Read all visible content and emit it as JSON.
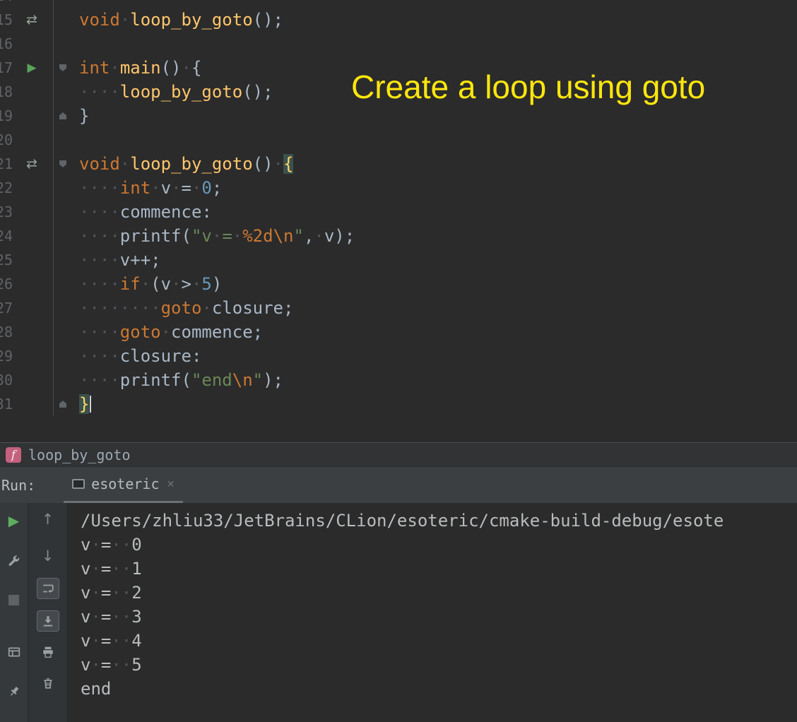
{
  "annotation": {
    "text": "Create a loop using goto",
    "color": "#fde60e"
  },
  "editor": {
    "lines": [
      {
        "n": "14",
        "tokens": []
      },
      {
        "n": "15",
        "g": "arrows",
        "tokens": [
          [
            "kw",
            "void"
          ],
          [
            "sp",
            " "
          ],
          [
            "fn",
            "loop_by_goto"
          ],
          [
            "txt",
            "();"
          ]
        ]
      },
      {
        "n": "16",
        "tokens": []
      },
      {
        "n": "17",
        "g": "run",
        "fold": "start",
        "tokens": [
          [
            "kw",
            "int"
          ],
          [
            "sp",
            " "
          ],
          [
            "fn",
            "main"
          ],
          [
            "txt",
            "()"
          ],
          [
            "sp",
            " "
          ],
          [
            "txt",
            "{"
          ]
        ]
      },
      {
        "n": "18",
        "tokens": [
          [
            "sp",
            "    "
          ],
          [
            "fn",
            "loop_by_goto"
          ],
          [
            "txt",
            "();"
          ]
        ]
      },
      {
        "n": "19",
        "fold": "end",
        "tokens": [
          [
            "txt",
            "}"
          ]
        ]
      },
      {
        "n": "20",
        "tokens": []
      },
      {
        "n": "21",
        "g": "arrows",
        "fold": "start",
        "tokens": [
          [
            "kw",
            "void"
          ],
          [
            "sp",
            " "
          ],
          [
            "fn",
            "loop_by_goto"
          ],
          [
            "txt",
            "()"
          ],
          [
            "sp",
            " "
          ],
          [
            "brace",
            "{"
          ]
        ]
      },
      {
        "n": "22",
        "tokens": [
          [
            "sp",
            "    "
          ],
          [
            "kw",
            "int"
          ],
          [
            "sp",
            " "
          ],
          [
            "txt",
            "v"
          ],
          [
            "sp",
            " "
          ],
          [
            "txt",
            "="
          ],
          [
            "sp",
            " "
          ],
          [
            "num",
            "0"
          ],
          [
            "txt",
            ";"
          ]
        ]
      },
      {
        "n": "23",
        "tokens": [
          [
            "sp",
            "    "
          ],
          [
            "txt",
            "commence:"
          ]
        ]
      },
      {
        "n": "24",
        "tokens": [
          [
            "sp",
            "    "
          ],
          [
            "txt",
            "printf("
          ],
          [
            "str",
            "\"v"
          ],
          [
            "sp",
            " "
          ],
          [
            "str",
            "="
          ],
          [
            "sp",
            " "
          ],
          [
            "fmt",
            "%2d"
          ],
          [
            "fmt",
            "\\n"
          ],
          [
            "str",
            "\""
          ],
          [
            "txt",
            ","
          ],
          [
            "sp",
            " "
          ],
          [
            "txt",
            "v);"
          ]
        ]
      },
      {
        "n": "25",
        "tokens": [
          [
            "sp",
            "    "
          ],
          [
            "txt",
            "v++;"
          ]
        ]
      },
      {
        "n": "26",
        "tokens": [
          [
            "sp",
            "    "
          ],
          [
            "kw",
            "if"
          ],
          [
            "sp",
            " "
          ],
          [
            "txt",
            "(v"
          ],
          [
            "sp",
            " "
          ],
          [
            "txt",
            ">"
          ],
          [
            "sp",
            " "
          ],
          [
            "num",
            "5"
          ],
          [
            "txt",
            ")"
          ]
        ]
      },
      {
        "n": "27",
        "tokens": [
          [
            "sp",
            "        "
          ],
          [
            "kw",
            "goto"
          ],
          [
            "sp",
            " "
          ],
          [
            "txt",
            "closure;"
          ]
        ]
      },
      {
        "n": "28",
        "tokens": [
          [
            "sp",
            "    "
          ],
          [
            "kw",
            "goto"
          ],
          [
            "sp",
            " "
          ],
          [
            "txt",
            "commence;"
          ]
        ]
      },
      {
        "n": "29",
        "tokens": [
          [
            "sp",
            "    "
          ],
          [
            "txt",
            "closure:"
          ]
        ]
      },
      {
        "n": "30",
        "tokens": [
          [
            "sp",
            "    "
          ],
          [
            "txt",
            "printf("
          ],
          [
            "str",
            "\"end"
          ],
          [
            "fmt",
            "\\n"
          ],
          [
            "str",
            "\""
          ],
          [
            "txt",
            ");"
          ]
        ]
      },
      {
        "n": "31",
        "fold": "end",
        "caret": true,
        "tokens": [
          [
            "brace",
            "}"
          ]
        ]
      }
    ]
  },
  "breadcrumb": {
    "icon": "f",
    "name": "loop_by_goto"
  },
  "run_panel": {
    "label": "Run:",
    "tab": "esoteric",
    "console_lines": [
      "/Users/zhliu33/JetBrains/CLion/esoteric/cmake-build-debug/esote",
      "v =  0",
      "v =  1",
      "v =  2",
      "v =  3",
      "v =  4",
      "v =  5",
      "end"
    ]
  },
  "icons": {
    "run": "▶",
    "nav_arrows": "⇄",
    "up": "↑",
    "down": "↓",
    "close": "×"
  },
  "colors": {
    "editor_bg": "#2b2b2b",
    "keyword": "#cc7832",
    "function": "#ffc66b",
    "string": "#6a8759",
    "number": "#6897bb",
    "default_text": "#a9b7c6",
    "line_number": "#606366",
    "run_green": "#58a45c",
    "breadcrumb_badge": "#c4617e",
    "annotation_yellow": "#fde60e"
  }
}
